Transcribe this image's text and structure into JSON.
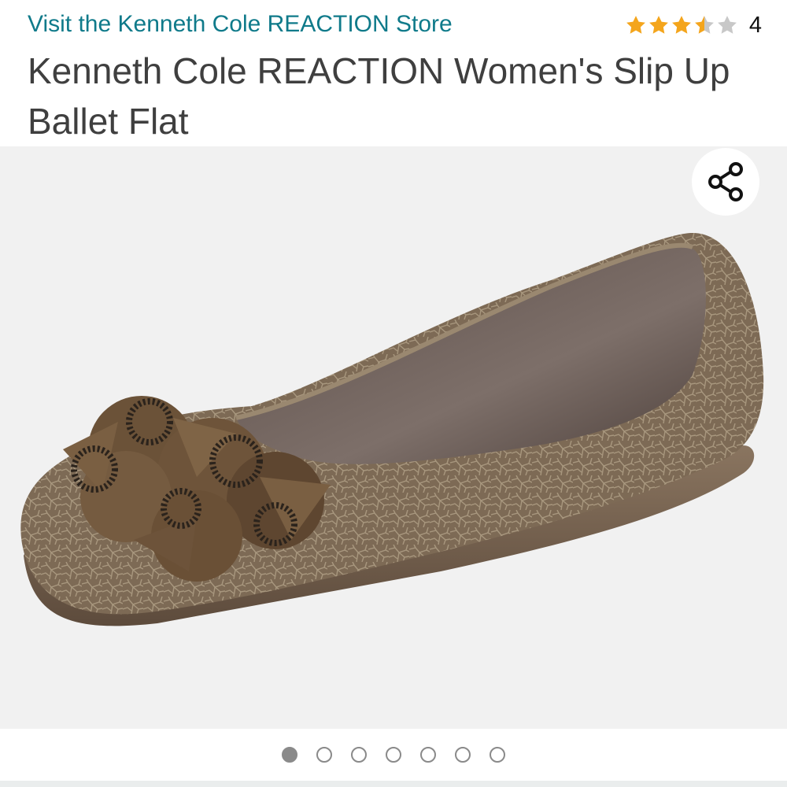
{
  "header": {
    "store_link": "Visit the Kenneth Cole REACTION Store",
    "rating": {
      "stars": 3.5,
      "max_stars": 5,
      "count": "4",
      "star_color": "#f4a51c",
      "empty_star_color": "#c8c8c8"
    },
    "title": "Kenneth Cole REACTION Women's Slip Up Ballet Flat"
  },
  "gallery": {
    "image_alt": "brown ballet flat with rosette bow",
    "share_icon": "share-icon",
    "image_count": 7,
    "active_index": 0
  },
  "colors": {
    "link": "#0f7a8a",
    "title": "#3f3f3f",
    "gallery_bg": "#f1f1f1",
    "dot": "#8a8a8a"
  }
}
